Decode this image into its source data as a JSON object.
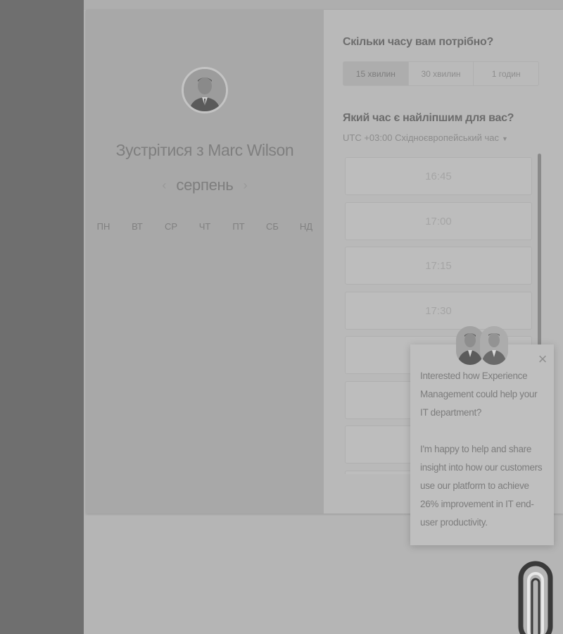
{
  "scheduler": {
    "host_title": "Зустрітися з Marc Wilson",
    "month": {
      "label": "серпень",
      "prev_icon": "chevron-left-icon",
      "next_icon": "chevron-right-icon"
    },
    "weekdays": [
      "ПН",
      "ВТ",
      "СР",
      "ЧТ",
      "ПТ",
      "СБ",
      "НД"
    ]
  },
  "duration": {
    "question": "Скільки часу вам потрібно?",
    "options": [
      {
        "label": "15 хвилин",
        "selected": true
      },
      {
        "label": "30 хвилин",
        "selected": false
      },
      {
        "label": "1 годин",
        "selected": false
      }
    ]
  },
  "time": {
    "question": "Який час є найліпшим для вас?",
    "timezone": "UTC +03:00 Східноєвропейський час",
    "timezone_caret_icon": "caret-down-icon",
    "slots": [
      "16:45",
      "17:00",
      "17:15",
      "17:30",
      "",
      "",
      "",
      ""
    ]
  },
  "chat": {
    "close_icon": "close-icon",
    "message_1": "Interested how Experience Management could help your IT department?",
    "message_2": "I'm happy to help and share insight into how our customers use our platform to achieve 26% improvement in IT end-user productivity."
  },
  "colors": {
    "overlay_gray": "#b8b8b8",
    "left_gutter": "#6f6f6f",
    "profile_panel": "#a8a8a8"
  }
}
